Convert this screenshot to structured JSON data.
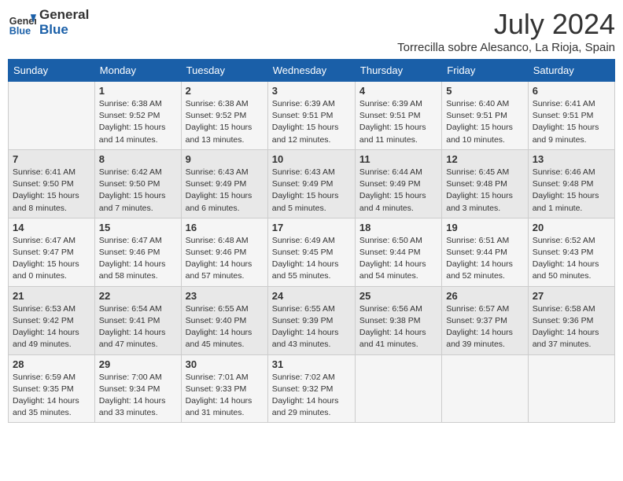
{
  "header": {
    "logo_line1": "General",
    "logo_line2": "Blue",
    "month": "July 2024",
    "location": "Torrecilla sobre Alesanco, La Rioja, Spain"
  },
  "days_of_week": [
    "Sunday",
    "Monday",
    "Tuesday",
    "Wednesday",
    "Thursday",
    "Friday",
    "Saturday"
  ],
  "weeks": [
    [
      {
        "day": "",
        "info": ""
      },
      {
        "day": "1",
        "info": "Sunrise: 6:38 AM\nSunset: 9:52 PM\nDaylight: 15 hours\nand 14 minutes."
      },
      {
        "day": "2",
        "info": "Sunrise: 6:38 AM\nSunset: 9:52 PM\nDaylight: 15 hours\nand 13 minutes."
      },
      {
        "day": "3",
        "info": "Sunrise: 6:39 AM\nSunset: 9:51 PM\nDaylight: 15 hours\nand 12 minutes."
      },
      {
        "day": "4",
        "info": "Sunrise: 6:39 AM\nSunset: 9:51 PM\nDaylight: 15 hours\nand 11 minutes."
      },
      {
        "day": "5",
        "info": "Sunrise: 6:40 AM\nSunset: 9:51 PM\nDaylight: 15 hours\nand 10 minutes."
      },
      {
        "day": "6",
        "info": "Sunrise: 6:41 AM\nSunset: 9:51 PM\nDaylight: 15 hours\nand 9 minutes."
      }
    ],
    [
      {
        "day": "7",
        "info": "Sunrise: 6:41 AM\nSunset: 9:50 PM\nDaylight: 15 hours\nand 8 minutes."
      },
      {
        "day": "8",
        "info": "Sunrise: 6:42 AM\nSunset: 9:50 PM\nDaylight: 15 hours\nand 7 minutes."
      },
      {
        "day": "9",
        "info": "Sunrise: 6:43 AM\nSunset: 9:49 PM\nDaylight: 15 hours\nand 6 minutes."
      },
      {
        "day": "10",
        "info": "Sunrise: 6:43 AM\nSunset: 9:49 PM\nDaylight: 15 hours\nand 5 minutes."
      },
      {
        "day": "11",
        "info": "Sunrise: 6:44 AM\nSunset: 9:49 PM\nDaylight: 15 hours\nand 4 minutes."
      },
      {
        "day": "12",
        "info": "Sunrise: 6:45 AM\nSunset: 9:48 PM\nDaylight: 15 hours\nand 3 minutes."
      },
      {
        "day": "13",
        "info": "Sunrise: 6:46 AM\nSunset: 9:48 PM\nDaylight: 15 hours\nand 1 minute."
      }
    ],
    [
      {
        "day": "14",
        "info": "Sunrise: 6:47 AM\nSunset: 9:47 PM\nDaylight: 15 hours\nand 0 minutes."
      },
      {
        "day": "15",
        "info": "Sunrise: 6:47 AM\nSunset: 9:46 PM\nDaylight: 14 hours\nand 58 minutes."
      },
      {
        "day": "16",
        "info": "Sunrise: 6:48 AM\nSunset: 9:46 PM\nDaylight: 14 hours\nand 57 minutes."
      },
      {
        "day": "17",
        "info": "Sunrise: 6:49 AM\nSunset: 9:45 PM\nDaylight: 14 hours\nand 55 minutes."
      },
      {
        "day": "18",
        "info": "Sunrise: 6:50 AM\nSunset: 9:44 PM\nDaylight: 14 hours\nand 54 minutes."
      },
      {
        "day": "19",
        "info": "Sunrise: 6:51 AM\nSunset: 9:44 PM\nDaylight: 14 hours\nand 52 minutes."
      },
      {
        "day": "20",
        "info": "Sunrise: 6:52 AM\nSunset: 9:43 PM\nDaylight: 14 hours\nand 50 minutes."
      }
    ],
    [
      {
        "day": "21",
        "info": "Sunrise: 6:53 AM\nSunset: 9:42 PM\nDaylight: 14 hours\nand 49 minutes."
      },
      {
        "day": "22",
        "info": "Sunrise: 6:54 AM\nSunset: 9:41 PM\nDaylight: 14 hours\nand 47 minutes."
      },
      {
        "day": "23",
        "info": "Sunrise: 6:55 AM\nSunset: 9:40 PM\nDaylight: 14 hours\nand 45 minutes."
      },
      {
        "day": "24",
        "info": "Sunrise: 6:55 AM\nSunset: 9:39 PM\nDaylight: 14 hours\nand 43 minutes."
      },
      {
        "day": "25",
        "info": "Sunrise: 6:56 AM\nSunset: 9:38 PM\nDaylight: 14 hours\nand 41 minutes."
      },
      {
        "day": "26",
        "info": "Sunrise: 6:57 AM\nSunset: 9:37 PM\nDaylight: 14 hours\nand 39 minutes."
      },
      {
        "day": "27",
        "info": "Sunrise: 6:58 AM\nSunset: 9:36 PM\nDaylight: 14 hours\nand 37 minutes."
      }
    ],
    [
      {
        "day": "28",
        "info": "Sunrise: 6:59 AM\nSunset: 9:35 PM\nDaylight: 14 hours\nand 35 minutes."
      },
      {
        "day": "29",
        "info": "Sunrise: 7:00 AM\nSunset: 9:34 PM\nDaylight: 14 hours\nand 33 minutes."
      },
      {
        "day": "30",
        "info": "Sunrise: 7:01 AM\nSunset: 9:33 PM\nDaylight: 14 hours\nand 31 minutes."
      },
      {
        "day": "31",
        "info": "Sunrise: 7:02 AM\nSunset: 9:32 PM\nDaylight: 14 hours\nand 29 minutes."
      },
      {
        "day": "",
        "info": ""
      },
      {
        "day": "",
        "info": ""
      },
      {
        "day": "",
        "info": ""
      }
    ]
  ]
}
